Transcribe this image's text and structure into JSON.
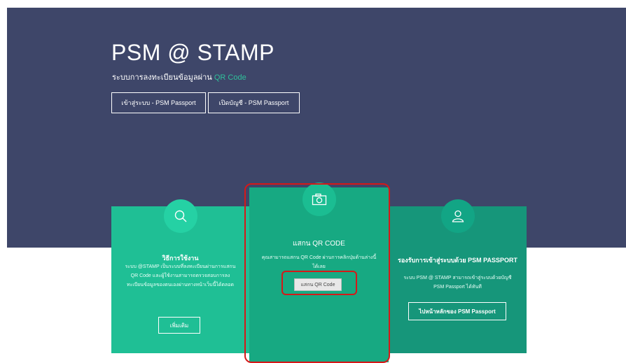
{
  "hero": {
    "title": "PSM @ STAMP",
    "subtitle_prefix": "ระบบการลงทะเบียนข้อมูลผ่าน ",
    "subtitle_highlight": "QR Code",
    "login_button": "เข้าสู่ระบบ - PSM Passport",
    "register_button": "เปิดบัญชี - PSM Passport"
  },
  "cards": {
    "howto": {
      "title": "วิธีการใช้งาน",
      "text": "ระบบ @STAMP เป็นระบบที่ลงทะเบียนผ่านการแสกน QR Code และผู้ใช้งานสามารถตรวจสอบการลงทะเบียนข้อมูลของตนเองผ่านทางหน้าเว็บนี้ได้ตลอด",
      "button": "เพิ่มเติม"
    },
    "scan": {
      "title": "แสกน QR CODE",
      "text": "คุณสามารถแสกน QR Code ผ่านการคลิกปุ่มด้านล่างนี้ได้เลย",
      "button": "แสกน QR Code"
    },
    "passport": {
      "title": "รองรับการเข้าสู่ระบบด้วย PSM PASSPORT",
      "text": "ระบบ PSM @ STAMP สามารถเข้าสู่ระบบด้วยบัญชี PSM Passport ได้ทันที",
      "button": "ไปหน้าหลักของ PSM Passport"
    }
  },
  "icons": {
    "howto": "search-icon",
    "scan": "camera-icon",
    "passport": "user-icon"
  },
  "colors": {
    "hero_bg": "#3e4669",
    "accent": "#2fc09a",
    "highlight": "#d61818"
  }
}
